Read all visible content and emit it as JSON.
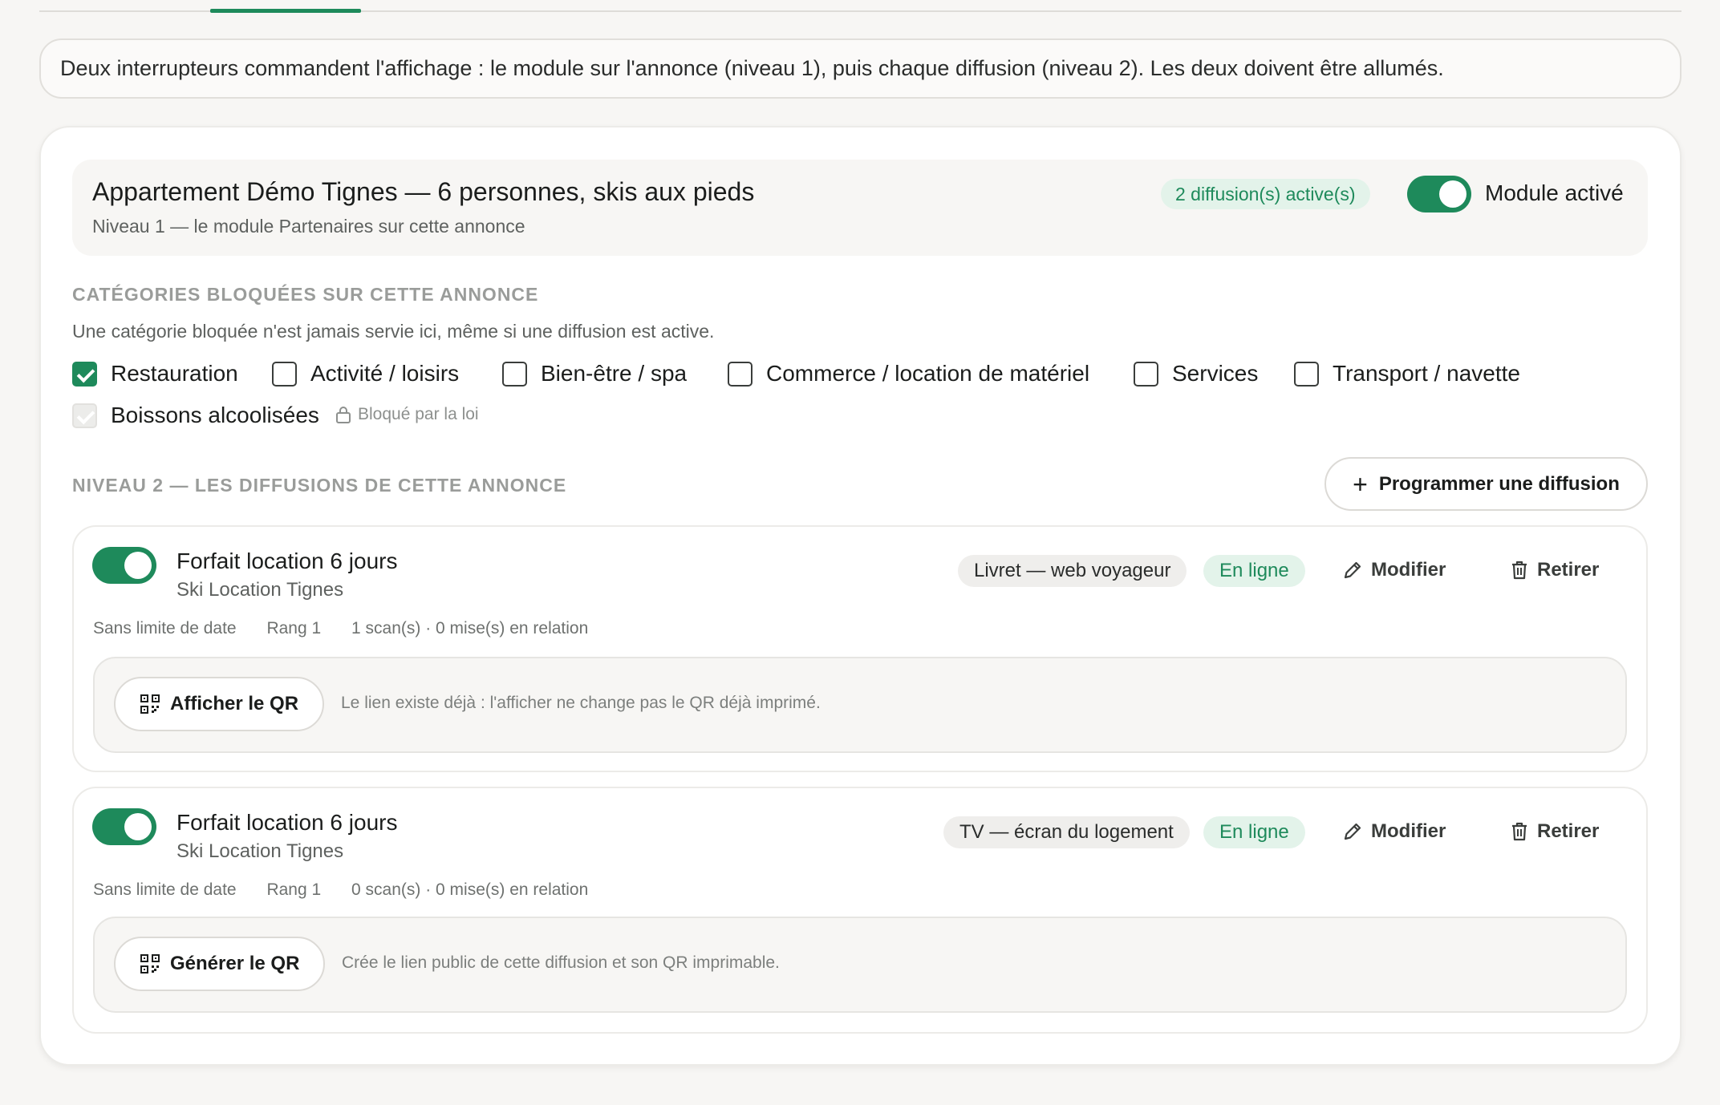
{
  "banner": {
    "text": "Deux interrupteurs commandent l'affichage : le module sur l'annonce (niveau 1), puis chaque diffusion (niveau 2). Les deux doivent être allumés."
  },
  "listing": {
    "title": "Appartement Démo Tignes — 6 personnes, skis aux pieds",
    "subtitle": "Niveau 1 — le module Partenaires sur cette annonce",
    "active_count": "2 diffusion(s) active(s)",
    "module_toggle_on": true,
    "module_label": "Module activé"
  },
  "categories": {
    "heading": "CATÉGORIES BLOQUÉES SUR CETTE ANNONCE",
    "help": "Une catégorie bloquée n'est jamais servie ici, même si une diffusion est active.",
    "items": [
      {
        "label": "Restauration",
        "checked": true
      },
      {
        "label": "Activité / loisirs",
        "checked": false
      },
      {
        "label": "Bien-être / spa",
        "checked": false
      },
      {
        "label": "Commerce / location de matériel",
        "checked": false
      },
      {
        "label": "Services",
        "checked": false
      },
      {
        "label": "Transport / navette",
        "checked": false
      },
      {
        "label": "Boissons alcoolisées",
        "checked": true,
        "disabled": true
      }
    ],
    "locked_note": "Bloqué par la loi"
  },
  "level2": {
    "heading": "NIVEAU 2 — LES DIFFUSIONS DE CETTE ANNONCE",
    "program_button": "Programmer une diffusion"
  },
  "diffusions": [
    {
      "title": "Forfait location 6 jours",
      "partner": "Ski Location Tignes",
      "channel": "Livret — web voyageur",
      "status": "En ligne",
      "edit_label": "Modifier",
      "remove_label": "Retirer",
      "meta_date": "Sans limite de date",
      "meta_rank": "Rang 1",
      "meta_stats": "1 scan(s) · 0 mise(s) en relation",
      "qr_button": "Afficher le QR",
      "qr_note": "Le lien existe déjà : l'afficher ne change pas le QR déjà imprimé.",
      "toggle_on": true
    },
    {
      "title": "Forfait location 6 jours",
      "partner": "Ski Location Tignes",
      "channel": "TV — écran du logement",
      "status": "En ligne",
      "edit_label": "Modifier",
      "remove_label": "Retirer",
      "meta_date": "Sans limite de date",
      "meta_rank": "Rang 1",
      "meta_stats": "0 scan(s) · 0 mise(s) en relation",
      "qr_button": "Générer le QR",
      "qr_note": "Crée le lien public de cette diffusion et son QR imprimable.",
      "toggle_on": true
    }
  ],
  "colors": {
    "accent": "#1e8a5b",
    "accent_soft": "#e3f3ea",
    "page_bg": "#f7f6f4"
  },
  "icons": {
    "plus": "plus-icon",
    "edit": "pencil-icon",
    "remove": "trash-icon",
    "qr": "qr-code-icon",
    "lock": "lock-icon"
  }
}
